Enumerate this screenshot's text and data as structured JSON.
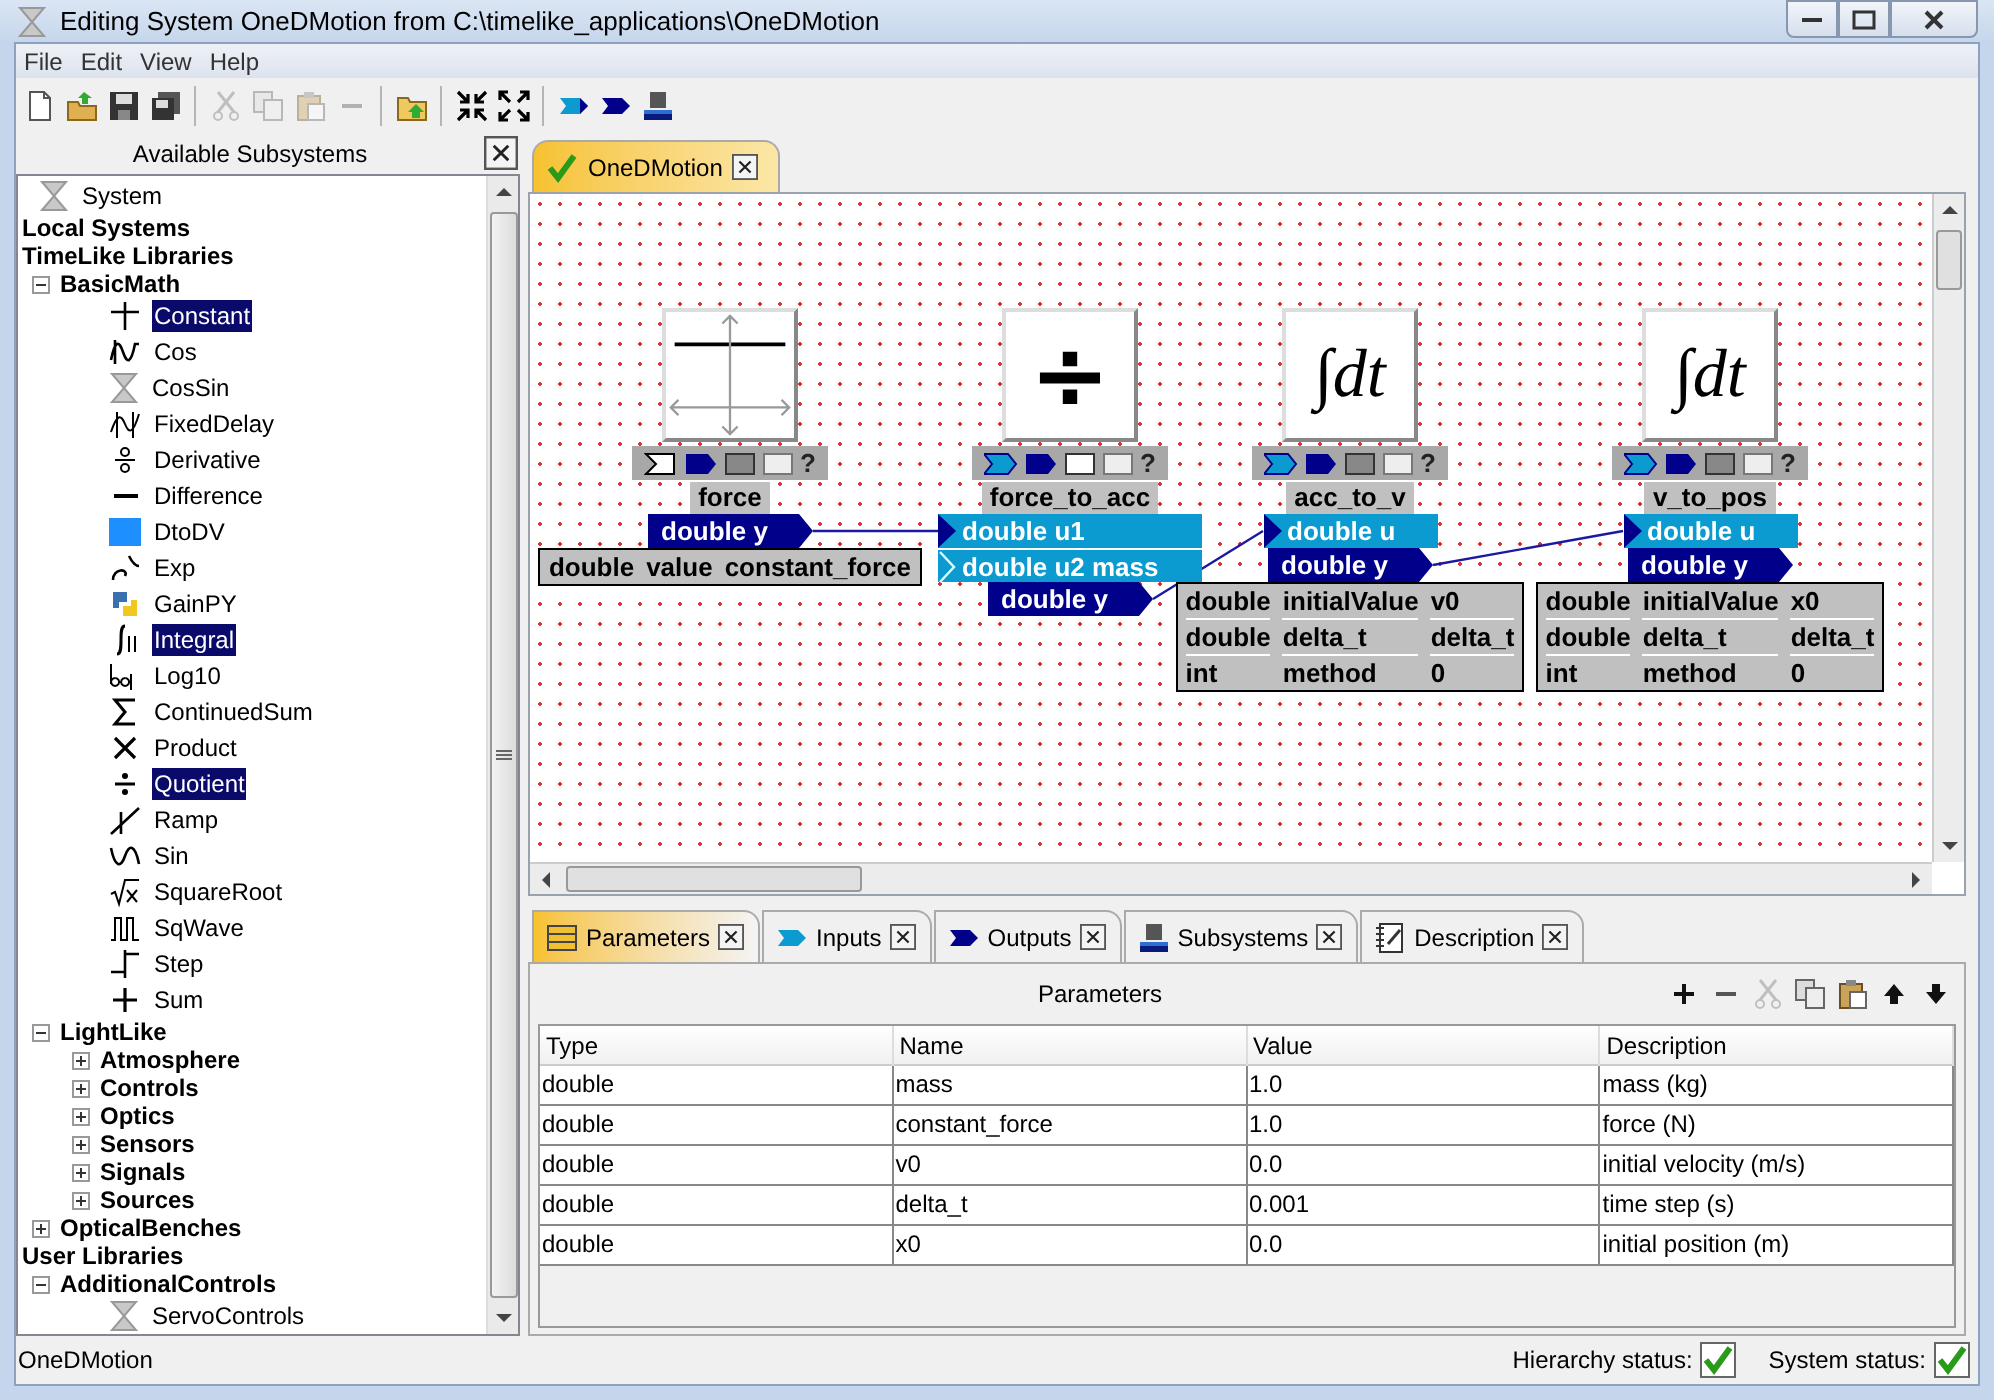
{
  "window": {
    "title": "Editing System OneDMotion from C:\\timelike_applications\\OneDMotion"
  },
  "menu": [
    "File",
    "Edit",
    "View",
    "Help"
  ],
  "toolbar": {
    "groups": [
      {
        "buttons": [
          {
            "kind": "new",
            "disabled": false
          },
          {
            "kind": "open",
            "disabled": false
          },
          {
            "kind": "save",
            "disabled": false
          },
          {
            "kind": "save_all",
            "disabled": false
          }
        ]
      },
      {
        "buttons": [
          {
            "kind": "cut",
            "disabled": true
          },
          {
            "kind": "copy",
            "disabled": true
          },
          {
            "kind": "paste",
            "disabled": true
          },
          {
            "kind": "remove",
            "disabled": true
          }
        ]
      },
      {
        "buttons": [
          {
            "kind": "folder_up",
            "disabled": false
          }
        ]
      },
      {
        "buttons": [
          {
            "kind": "collapse",
            "disabled": false
          },
          {
            "kind": "expand",
            "disabled": false
          }
        ]
      },
      {
        "buttons": [
          {
            "kind": "input_port",
            "disabled": false
          },
          {
            "kind": "output_port",
            "disabled": false
          },
          {
            "kind": "subsystem",
            "disabled": false
          }
        ]
      }
    ]
  },
  "sidebar": {
    "title": "Available Subsystems",
    "tree": [
      {
        "label": "System",
        "kind": "system",
        "selected": false
      },
      {
        "label": "Local Systems",
        "kind": "group"
      },
      {
        "label": "TimeLike Libraries",
        "kind": "group",
        "children": [
          {
            "label": "BasicMath",
            "kind": "group",
            "expanded": true,
            "children": [
              {
                "label": "Constant",
                "kind": "block",
                "selected": true
              },
              {
                "label": "Cos",
                "kind": "block",
                "selected": false
              },
              {
                "label": "CosSin",
                "kind": "system",
                "selected": false
              },
              {
                "label": "FixedDelay",
                "kind": "block",
                "selected": false
              },
              {
                "label": "Derivative",
                "kind": "block",
                "selected": false
              },
              {
                "label": "Difference",
                "kind": "block",
                "selected": false
              },
              {
                "label": "DtoDV",
                "kind": "block",
                "selected": false
              },
              {
                "label": "Exp",
                "kind": "block",
                "selected": false
              },
              {
                "label": "GainPY",
                "kind": "block",
                "selected": false
              },
              {
                "label": "Integral",
                "kind": "block",
                "selected": true
              },
              {
                "label": "Log10",
                "kind": "block",
                "selected": false
              },
              {
                "label": "ContinuedSum",
                "kind": "block",
                "selected": false
              },
              {
                "label": "Product",
                "kind": "block",
                "selected": false
              },
              {
                "label": "Quotient",
                "kind": "block",
                "selected": true
              },
              {
                "label": "Ramp",
                "kind": "block",
                "selected": false
              },
              {
                "label": "Sin",
                "kind": "block",
                "selected": false
              },
              {
                "label": "SquareRoot",
                "kind": "block",
                "selected": false
              },
              {
                "label": "SqWave",
                "kind": "block",
                "selected": false
              },
              {
                "label": "Step",
                "kind": "block",
                "selected": false
              },
              {
                "label": "Sum",
                "kind": "block",
                "selected": false
              }
            ]
          },
          {
            "label": "LightLike",
            "kind": "group",
            "expanded": true,
            "children": [
              {
                "label": "Atmosphere",
                "kind": "group",
                "expanded": false
              },
              {
                "label": "Controls",
                "kind": "group",
                "expanded": false
              },
              {
                "label": "Optics",
                "kind": "group",
                "expanded": false
              },
              {
                "label": "Sensors",
                "kind": "group",
                "expanded": false
              },
              {
                "label": "Signals",
                "kind": "group",
                "expanded": false
              },
              {
                "label": "Sources",
                "kind": "group",
                "expanded": false
              }
            ]
          },
          {
            "label": "OpticalBenches",
            "kind": "group",
            "expanded": false
          }
        ]
      },
      {
        "label": "User Libraries",
        "kind": "group",
        "children": [
          {
            "label": "AdditionalControls",
            "kind": "group",
            "expanded": true,
            "children": [
              {
                "label": "ServoControls",
                "kind": "system",
                "selected": false
              }
            ]
          }
        ]
      }
    ]
  },
  "document_tabs": [
    {
      "label": "OneDMotion",
      "selected": true
    }
  ],
  "diagram": {
    "blocks": [
      {
        "name": "force",
        "kind": "constant",
        "help_button": "?",
        "outputs": [
          "double y"
        ],
        "parameters": [
          {
            "type": "double",
            "name": "value",
            "value": "constant_force"
          }
        ]
      },
      {
        "name": "force_to_acc",
        "kind": "quotient",
        "symbol": "÷",
        "help_button": "?",
        "inputs": [
          {
            "label": "double u1",
            "connected": true
          },
          {
            "label": "double u2 mass",
            "connected": false
          }
        ],
        "outputs": [
          "double y"
        ]
      },
      {
        "name": "acc_to_v",
        "kind": "integral",
        "symbol": "∫dt",
        "help_button": "?",
        "inputs": [
          {
            "label": "double u",
            "connected": true
          }
        ],
        "outputs": [
          "double y"
        ],
        "parameters": [
          {
            "type": "double",
            "name": "initialValue",
            "value": "v0"
          },
          {
            "type": "double",
            "name": "delta_t",
            "value": "delta_t"
          },
          {
            "type": "int",
            "name": "method",
            "value": "0"
          }
        ]
      },
      {
        "name": "v_to_pos",
        "kind": "integral",
        "symbol": "∫dt",
        "help_button": "?",
        "inputs": [
          {
            "label": "double u",
            "connected": true
          }
        ],
        "outputs": [
          "double y"
        ],
        "parameters": [
          {
            "type": "double",
            "name": "initialValue",
            "value": "x0"
          },
          {
            "type": "double",
            "name": "delta_t",
            "value": "delta_t"
          },
          {
            "type": "int",
            "name": "method",
            "value": "0"
          }
        ]
      }
    ]
  },
  "panel_tabs": [
    {
      "kind": "parameters",
      "label": "Parameters",
      "selected": true
    },
    {
      "kind": "inputs",
      "label": "Inputs",
      "selected": false
    },
    {
      "kind": "outputs",
      "label": "Outputs",
      "selected": false
    },
    {
      "kind": "subsystems",
      "label": "Subsystems",
      "selected": false
    },
    {
      "kind": "description",
      "label": "Description",
      "selected": false
    }
  ],
  "parameters_panel": {
    "title": "Parameters",
    "tools": [
      {
        "kind": "add",
        "disabled": false
      },
      {
        "kind": "remove",
        "disabled": false
      },
      {
        "kind": "cut",
        "disabled": true
      },
      {
        "kind": "copy",
        "disabled": false
      },
      {
        "kind": "paste",
        "disabled": false
      },
      {
        "kind": "move_up",
        "disabled": false
      },
      {
        "kind": "move_down",
        "disabled": false
      }
    ],
    "table": {
      "columns": [
        "Type",
        "Name",
        "Value",
        "Description"
      ],
      "rows": [
        [
          "double",
          "mass",
          "1.0",
          "mass (kg)"
        ],
        [
          "double",
          "constant_force",
          "1.0",
          "force (N)"
        ],
        [
          "double",
          "v0",
          "0.0",
          "initial velocity (m/s)"
        ],
        [
          "double",
          "delta_t",
          "0.001",
          "time step (s)"
        ],
        [
          "double",
          "x0",
          "0.0",
          "initial position (m)"
        ]
      ]
    }
  },
  "status_bar": {
    "system": "OneDMotion",
    "indicators": [
      {
        "label": "Hierarchy status:",
        "ok": true
      },
      {
        "label": "System status:",
        "ok": true
      }
    ]
  }
}
